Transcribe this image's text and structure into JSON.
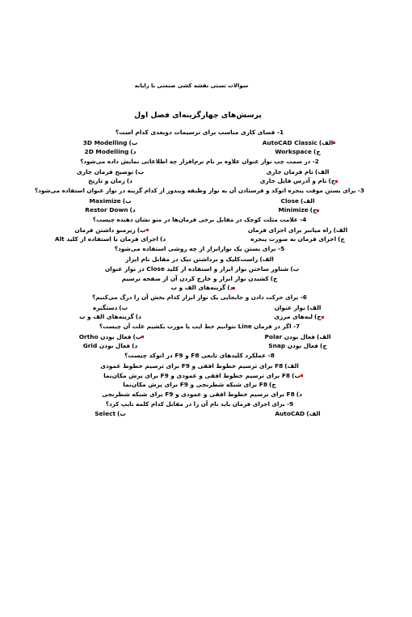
{
  "document": {
    "header": "سوالات تستی نقشه کشی صنعتی با رایانه",
    "title": "پرسش‌های چهارگزینه‌ای فصل اول",
    "accent_color": "#e00000",
    "text_color": "#000000",
    "background_color": "#ffffff"
  },
  "questions": [
    {
      "number": "1-",
      "stem": "1- فضای کاری مناسب برای ترسیمات دوبعدی کدام است؟",
      "options": [
        {
          "key": "الف)",
          "text": "AutoCAD Classic",
          "latin": true,
          "correct": true
        },
        {
          "key": "ب)",
          "text": "3D Modelling",
          "latin": true,
          "correct": false
        },
        {
          "key": "ج)",
          "text": "Workspace",
          "latin": true,
          "correct": false
        },
        {
          "key": "د)",
          "text": "2D Modelling",
          "latin": true,
          "correct": false
        }
      ]
    },
    {
      "number": "2-",
      "stem": "2- در سمت چپ نوار عنوان علاوه بر نام نرم‌افزار چه اطلاعاتی نمایش داده می‌شود؟",
      "options": [
        {
          "key": "الف)",
          "text": "نام فرمان جاری",
          "latin": false,
          "correct": false
        },
        {
          "key": "ب)",
          "text": "توضیح فرمان جاری",
          "latin": false,
          "correct": false
        },
        {
          "key": "ج)",
          "text": "نام و آدرس فایل جاری",
          "latin": false,
          "correct": true
        },
        {
          "key": "د)",
          "text": "زمان و تاریخ",
          "latin": false,
          "correct": false
        }
      ]
    },
    {
      "number": "3-",
      "stem": "3- برای بستن موقت پنجره اتوکد و فرستادن آن به نوار وظیفه ویندوز از کدام گزینه در نوار عنوان استفاده می‌شود؟",
      "options": [
        {
          "key": "الف)",
          "text": "Close",
          "latin": true,
          "correct": false
        },
        {
          "key": "ب)",
          "text": "Maximize",
          "latin": true,
          "correct": false
        },
        {
          "key": "ج)",
          "text": "Minimize",
          "latin": true,
          "correct": true
        },
        {
          "key": "د)",
          "text": "Restor Down",
          "latin": true,
          "correct": false
        }
      ]
    },
    {
      "number": "4-",
      "stem": "4- علامت مثلث کوچک در مقابل برخی فرمان‌ها در منو نشان دهنده چیست؟",
      "options": [
        {
          "key": "الف)",
          "text": "راه میانبر برای اجرای فرمان",
          "latin": false,
          "correct": false
        },
        {
          "key": "ب)",
          "text": "زیرمنو داشتن فرمان",
          "latin": false,
          "correct": true
        },
        {
          "key": "ج)",
          "text": "اجرای فرمان به صورت پنجره",
          "latin": false,
          "correct": false
        },
        {
          "key": "د)",
          "text": "اجرای فرمان با استفاده از کلید Alt",
          "latin": false,
          "correct": false
        }
      ]
    },
    {
      "number": "5-",
      "stem": "5- برای بستن یک نوارابزار از چه روشی استفاده می‌شود؟",
      "options": [
        {
          "key": "الف)",
          "text": "راست‌کلیک و برداشتن تیک در مقابل نام ابزار",
          "latin": false,
          "correct": false
        },
        {
          "key": "ب)",
          "text": "شناور ساختن نوار ابزار و استفاده از کلید Close در نوار عنوان",
          "latin": false,
          "correct": false
        },
        {
          "key": "ج)",
          "text": "کشیدن نوار ابزار و خارج کردن آن از صفحه ترسیم",
          "latin": false,
          "correct": false
        },
        {
          "key": "د)",
          "text": "گزینه‌های الف و ب",
          "latin": false,
          "correct": true
        }
      ]
    },
    {
      "number": "6-",
      "stem": "6- برای حرکت دادن و جابجایی یک نوار ابزار کدام بخش آن را درگ می‌کنیم؟",
      "options": [
        {
          "key": "الف)",
          "text": "نوار عنوان",
          "latin": false,
          "correct": false
        },
        {
          "key": "ب)",
          "text": "دستگیره",
          "latin": false,
          "correct": false
        },
        {
          "key": "ج)",
          "text": "لبه‌های مرزی",
          "latin": false,
          "correct": true
        },
        {
          "key": "د)",
          "text": "گزینه‌های الف و ب",
          "latin": false,
          "correct": false
        }
      ]
    },
    {
      "number": "7-",
      "stem": "7- اگر در فرمان Line نتوانیم خط ایب یا مورب بکشیم علت آن چیست؟",
      "options": [
        {
          "key": "الف)",
          "text": "فعال بودن Polar",
          "latin": false,
          "correct": false
        },
        {
          "key": "ب)",
          "text": "فعال بودن Ortho",
          "latin": false,
          "correct": true
        },
        {
          "key": "ج)",
          "text": "فعال بودن Snap",
          "latin": false,
          "correct": false
        },
        {
          "key": "د)",
          "text": "فعال بودن Grid",
          "latin": false,
          "correct": false
        }
      ]
    },
    {
      "number": "8-",
      "stem": "8- عملکرد کلیدهای تابعی F8 و F9 در اتوکد چیست؟",
      "options": [
        {
          "key": "الف)",
          "text": "F8 برای ترسیم خطوط افقی و  F9 برای ترسیم خطوط عمودی",
          "latin": false,
          "correct": false
        },
        {
          "key": "ب)",
          "text": "F8 برای ترسیم خطوط افقی و عمودی و  F9 برای پرش مکان‌نما",
          "latin": false,
          "correct": true
        },
        {
          "key": "ج)",
          "text": "F8 برای شبکه شطرنجی و  F9 برای پرش مکان‌نما",
          "latin": false,
          "correct": false
        },
        {
          "key": "د)",
          "text": "F8 برای ترسیم خطوط افقی و عمودی و  F9 برای شبکه شطرنجی",
          "latin": false,
          "correct": false
        }
      ]
    },
    {
      "number": "9-",
      "stem": "9- برای اجرای فرمان باید نام آن را در مقابل کدام کلمه تایپ کرد؟",
      "options": [
        {
          "key": "الف)",
          "text": "AutoCAD",
          "latin": true,
          "correct": false
        },
        {
          "key": "ب)",
          "text": "Select",
          "latin": true,
          "correct": false
        }
      ]
    }
  ]
}
